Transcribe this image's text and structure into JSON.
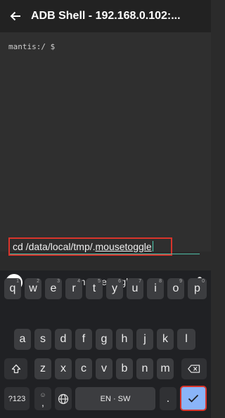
{
  "appbar": {
    "title": "ADB Shell - 192.168.0.102:..."
  },
  "terminal": {
    "prompt": "mantis:/ $"
  },
  "command": {
    "prefix": "cd /data/local/tmp/.",
    "underlined": "mousetoggle"
  },
  "keyboard": {
    "suggestion": "mousetoggle",
    "row1": [
      {
        "label": "q",
        "num": "1"
      },
      {
        "label": "w",
        "num": "2"
      },
      {
        "label": "e",
        "num": "3"
      },
      {
        "label": "r",
        "num": "4"
      },
      {
        "label": "t",
        "num": "5"
      },
      {
        "label": "y",
        "num": "6"
      },
      {
        "label": "u",
        "num": "7"
      },
      {
        "label": "i",
        "num": "8"
      },
      {
        "label": "o",
        "num": "9"
      },
      {
        "label": "p",
        "num": "0"
      }
    ],
    "row2": [
      "a",
      "s",
      "d",
      "f",
      "g",
      "h",
      "j",
      "k",
      "l"
    ],
    "row3": [
      "z",
      "x",
      "c",
      "v",
      "b",
      "n",
      "m"
    ],
    "symbols_label": "?123",
    "comma_label": ",",
    "emoji_label": "☺",
    "space_label": "EN · SW",
    "period_label": "."
  },
  "colors": {
    "highlight": "#d9342b",
    "enter_key": "#8ab4f8",
    "accent": "#4fbfa9"
  }
}
